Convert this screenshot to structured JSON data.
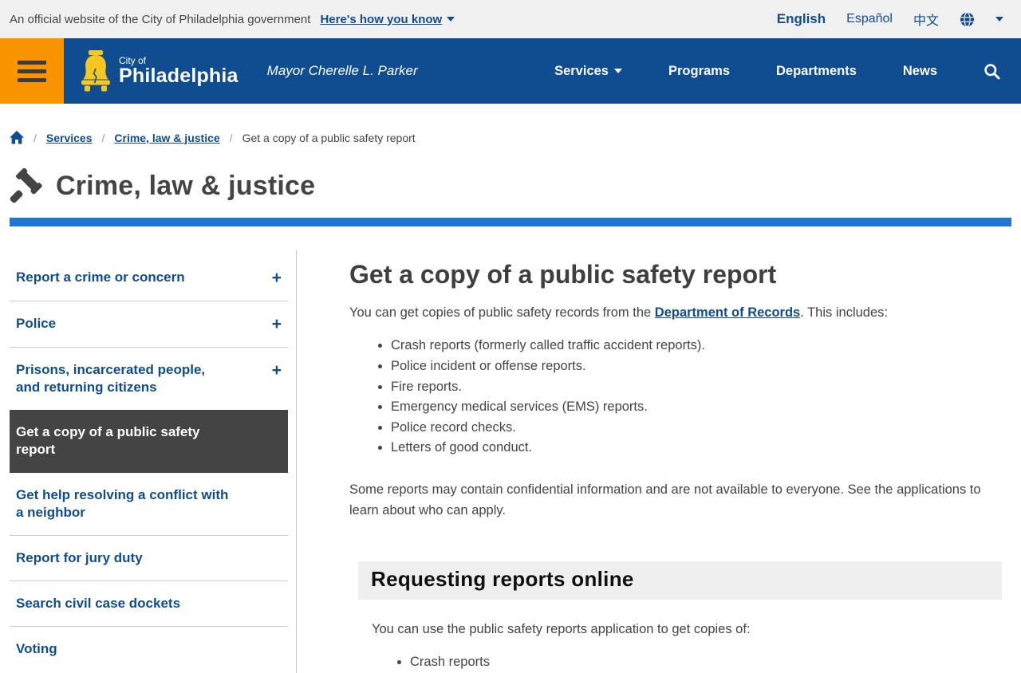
{
  "colors": {
    "dark_blue": "#0f4d90",
    "bright_blue": "#2176d2",
    "orange": "#f99300",
    "dark_gray": "#444444"
  },
  "banner": {
    "official": "An official website of the City of Philadelphia government",
    "how_you_know": "Here's how you know",
    "lang_english": "English",
    "lang_espanol": "Español",
    "lang_chinese": "中文"
  },
  "header": {
    "logo_top": "City of",
    "logo_bottom": "Philadelphia",
    "mayor": "Mayor Cherelle L. Parker",
    "nav_services": "Services",
    "nav_programs": "Programs",
    "nav_departments": "Departments",
    "nav_news": "News"
  },
  "breadcrumb": {
    "sep": "/",
    "services": "Services",
    "category": "Crime, law & justice",
    "current": "Get a copy of a public safety report"
  },
  "page": {
    "title": "Crime, law & justice"
  },
  "sidebar": {
    "plus": "+",
    "items": [
      {
        "label": "Report a crime or concern"
      },
      {
        "label": "Police"
      },
      {
        "label": "Prisons, incarcerated people, and returning citizens"
      },
      {
        "label": "Get a copy of a public safety report"
      },
      {
        "label": "Get help resolving a conflict with a neighbor"
      },
      {
        "label": "Report for jury duty"
      },
      {
        "label": "Search civil case dockets"
      },
      {
        "label": "Voting"
      }
    ]
  },
  "main": {
    "title": "Get a copy of a public safety report",
    "intro_before": "You can get copies of public safety records from the ",
    "intro_link": "Department of Records",
    "intro_after": ". This includes:",
    "bullets": [
      "Crash reports (formerly called traffic accident reports).",
      "Police incident or offense reports.",
      "Fire reports.",
      "Emergency medical services (EMS) reports.",
      "Police record checks.",
      "Letters of good conduct."
    ],
    "note": "Some reports may contain confidential information and are not available to everyone. See the applications to learn about who can apply.",
    "section_title": "Requesting reports online",
    "section_intro": "You can use the public safety reports application to get copies of:",
    "section_bullets": [
      "Crash reports"
    ]
  }
}
